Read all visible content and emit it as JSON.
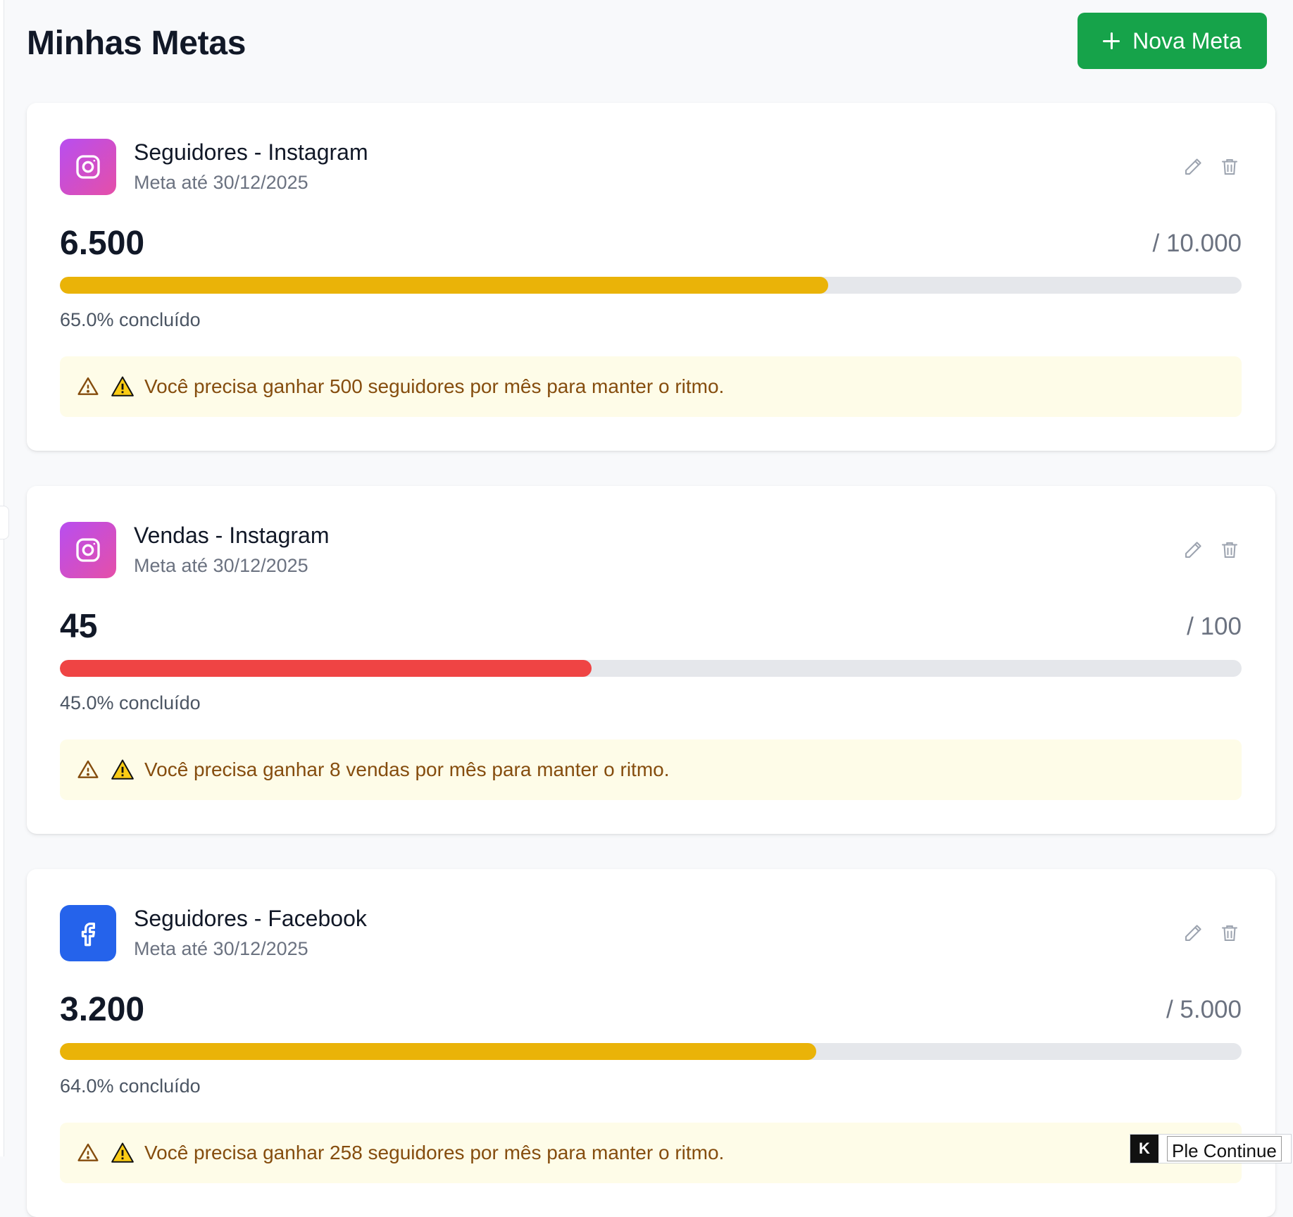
{
  "header": {
    "title": "Minhas Metas",
    "new_button_label": "Nova Meta"
  },
  "colors": {
    "primary_green": "#16a34a",
    "progress_yellow": "#eab308",
    "progress_red": "#ef4444",
    "instagram_gradient": [
      "#b84ef0",
      "#e54fa8"
    ],
    "facebook_blue": "#2563eb",
    "alert_bg": "#fefce8",
    "alert_text": "#854d0e"
  },
  "goals": [
    {
      "platform_icon": "instagram-icon",
      "title": "Seguidores - Instagram",
      "deadline": "Meta até 30/12/2025",
      "current": "6.500",
      "target": "/ 10.000",
      "progress": 0.65,
      "progress_color": "#eab308",
      "percent_label": "65.0% concluído",
      "alert": "Você precisa ganhar 500 seguidores por mês para manter o ritmo."
    },
    {
      "platform_icon": "instagram-icon",
      "title": "Vendas - Instagram",
      "deadline": "Meta até 30/12/2025",
      "current": "45",
      "target": "/ 100",
      "progress": 0.45,
      "progress_color": "#ef4444",
      "percent_label": "45.0% concluído",
      "alert": "Você precisa ganhar 8 vendas por mês para manter o ritmo."
    },
    {
      "platform_icon": "facebook-icon",
      "title": "Seguidores - Facebook",
      "deadline": "Meta até 30/12/2025",
      "current": "3.200",
      "target": "/ 5.000",
      "progress": 0.64,
      "progress_color": "#eab308",
      "percent_label": "64.0% concluído",
      "alert": "Você precisa ganhar 258 seguidores por mês para manter o ritmo."
    }
  ],
  "corner_widget": {
    "logo_letter": "K",
    "text": "Ple Continue"
  }
}
